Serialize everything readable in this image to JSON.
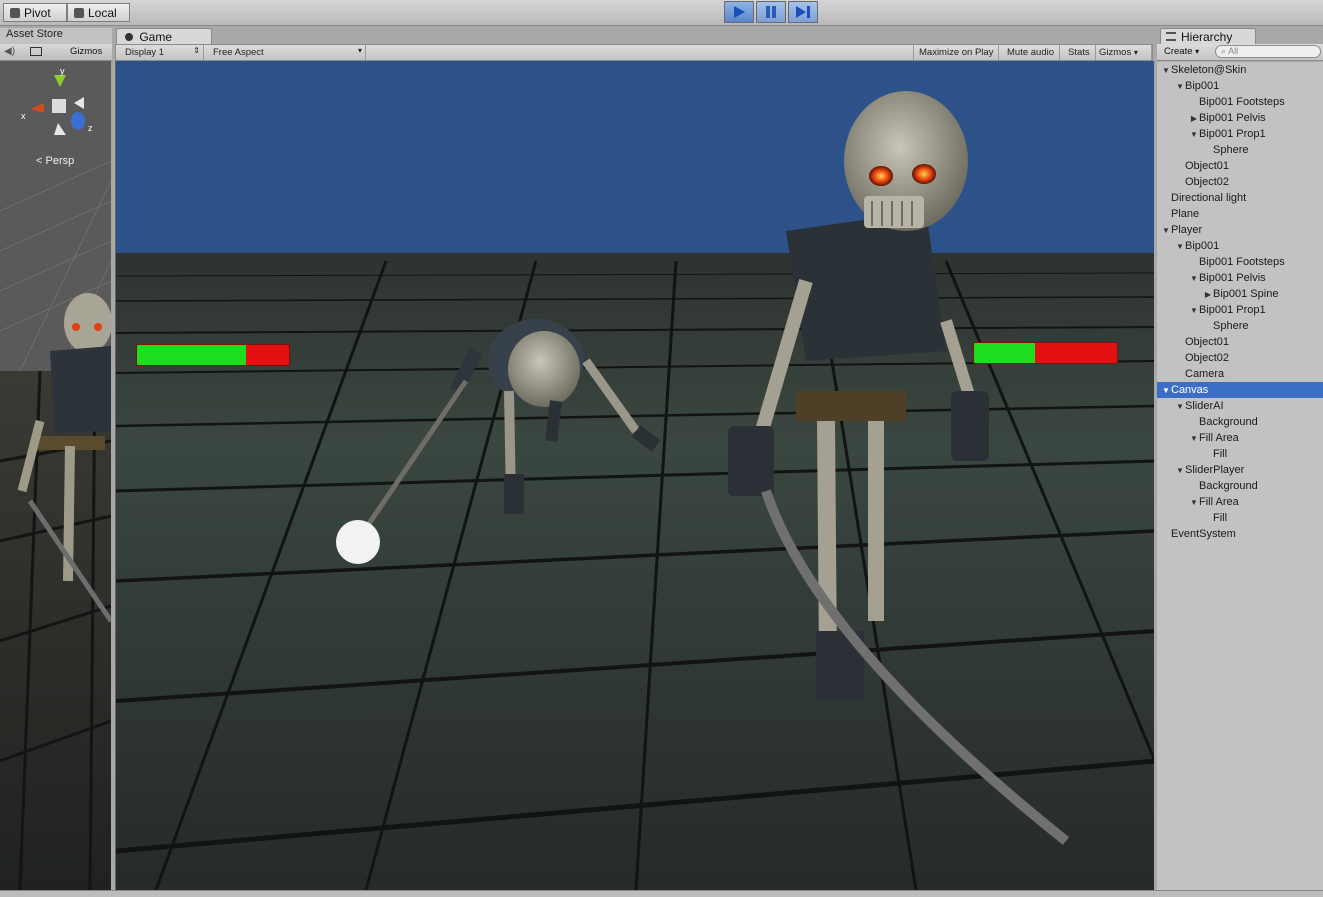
{
  "toolbar": {
    "pivot_label": "Pivot",
    "local_label": "Local",
    "play_icon": "play-icon",
    "pause_icon": "pause-icon",
    "step_icon": "step-icon"
  },
  "scene": {
    "tab_label": "Asset Store",
    "gizmos_label": "Gizmos",
    "persp_label": "Persp",
    "axis_x": "x",
    "axis_y": "y",
    "axis_z": "z"
  },
  "game": {
    "tab_label": "Game",
    "display": "Display 1",
    "aspect": "Free Aspect",
    "maximize_label": "Maximize on Play",
    "mute_label": "Mute audio",
    "stats_label": "Stats",
    "gizmos_label": "Gizmos",
    "health_bars": [
      {
        "name": "ai",
        "fill": 0.72
      },
      {
        "name": "player",
        "fill": 0.43
      }
    ],
    "colors": {
      "health_fill": "#1edc1e",
      "health_background": "#e21010",
      "sky": "#2d5289"
    }
  },
  "hierarchy": {
    "tab_label": "Hierarchy",
    "create_label": "Create",
    "search_placeholder": "All",
    "items": [
      {
        "label": "Skeleton@Skin",
        "depth": 0,
        "arrow": "down"
      },
      {
        "label": "Bip001",
        "depth": 1,
        "arrow": "down"
      },
      {
        "label": "Bip001 Footsteps",
        "depth": 2,
        "arrow": ""
      },
      {
        "label": "Bip001 Pelvis",
        "depth": 2,
        "arrow": "right"
      },
      {
        "label": "Bip001 Prop1",
        "depth": 2,
        "arrow": "down"
      },
      {
        "label": "Sphere",
        "depth": 3,
        "arrow": ""
      },
      {
        "label": "Object01",
        "depth": 1,
        "arrow": ""
      },
      {
        "label": "Object02",
        "depth": 1,
        "arrow": ""
      },
      {
        "label": "Directional light",
        "depth": 0,
        "arrow": ""
      },
      {
        "label": "Plane",
        "depth": 0,
        "arrow": ""
      },
      {
        "label": "Player",
        "depth": 0,
        "arrow": "down"
      },
      {
        "label": "Bip001",
        "depth": 1,
        "arrow": "down"
      },
      {
        "label": "Bip001 Footsteps",
        "depth": 2,
        "arrow": ""
      },
      {
        "label": "Bip001 Pelvis",
        "depth": 2,
        "arrow": "down"
      },
      {
        "label": "Bip001 Spine",
        "depth": 3,
        "arrow": "right"
      },
      {
        "label": "Bip001 Prop1",
        "depth": 2,
        "arrow": "down"
      },
      {
        "label": "Sphere",
        "depth": 3,
        "arrow": ""
      },
      {
        "label": "Object01",
        "depth": 1,
        "arrow": ""
      },
      {
        "label": "Object02",
        "depth": 1,
        "arrow": ""
      },
      {
        "label": "Camera",
        "depth": 1,
        "arrow": ""
      },
      {
        "label": "Canvas",
        "depth": 0,
        "arrow": "down",
        "selected": true
      },
      {
        "label": "SliderAI",
        "depth": 1,
        "arrow": "down"
      },
      {
        "label": "Background",
        "depth": 2,
        "arrow": ""
      },
      {
        "label": "Fill Area",
        "depth": 2,
        "arrow": "down"
      },
      {
        "label": "Fill",
        "depth": 3,
        "arrow": ""
      },
      {
        "label": "SliderPlayer",
        "depth": 1,
        "arrow": "down"
      },
      {
        "label": "Background",
        "depth": 2,
        "arrow": ""
      },
      {
        "label": "Fill Area",
        "depth": 2,
        "arrow": "down"
      },
      {
        "label": "Fill",
        "depth": 3,
        "arrow": ""
      },
      {
        "label": "EventSystem",
        "depth": 0,
        "arrow": ""
      }
    ]
  }
}
